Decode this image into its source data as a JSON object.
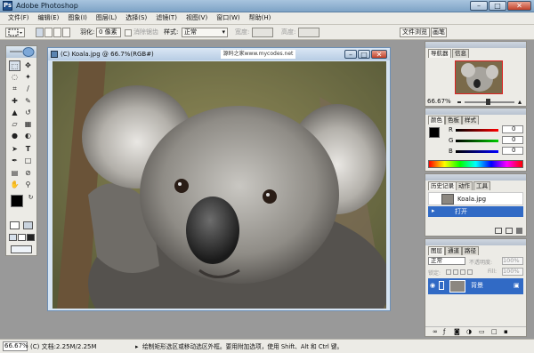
{
  "window": {
    "title": "Adobe Photoshop",
    "app_icon_glyph": "Ps",
    "minimize_glyph": "–",
    "maximize_glyph": "□",
    "close_glyph": "✕"
  },
  "menu": [
    "文件(F)",
    "编辑(E)",
    "图象(I)",
    "图层(L)",
    "选择(S)",
    "滤镜(T)",
    "视图(V)",
    "窗口(W)",
    "帮助(H)"
  ],
  "options": {
    "feather_label": "羽化:",
    "feather_value": "0 像素",
    "antialias_label": "消除锯齿",
    "style_label": "样式:",
    "style_value": "正常",
    "width_label": "宽度:",
    "height_label": "高度:",
    "browser_tab": "文件浏览",
    "brush_tab": "画笔"
  },
  "document": {
    "title": "(C) Koala.jpg @ 66.7%(RGB#)",
    "watermark": "源码之家www.mycodes.net"
  },
  "navigator": {
    "tab_active": "导航器",
    "tab_info": "信息",
    "zoom": "66.67%"
  },
  "color": {
    "tab_active": "颜色",
    "tab_swatches": "色板",
    "tab_styles": "样式",
    "r_label": "R",
    "g_label": "G",
    "b_label": "B",
    "r_value": "0",
    "g_value": "0",
    "b_value": "0"
  },
  "history": {
    "tab_active": "历史记录",
    "tab_actions": "动作",
    "tab_tools": "工具",
    "snapshot": "Koala.jpg",
    "state": "打开"
  },
  "layers": {
    "tab_active": "图层",
    "tab_channels": "通道",
    "tab_paths": "路径",
    "blend_mode": "正常",
    "opacity_label": "不透明度:",
    "opacity_value": "100%",
    "lock_label": "锁定:",
    "fill_label": "Fill:",
    "fill_value": "100%",
    "layer_name": "背景"
  },
  "status": {
    "zoom": "66.67%",
    "doc_info": "(C) 文档:2.25M/2.25M",
    "hint": "绘制矩形选区或移动选区外框。要用附加选项，使用 Shift、Alt 和 Ctrl 键。"
  }
}
